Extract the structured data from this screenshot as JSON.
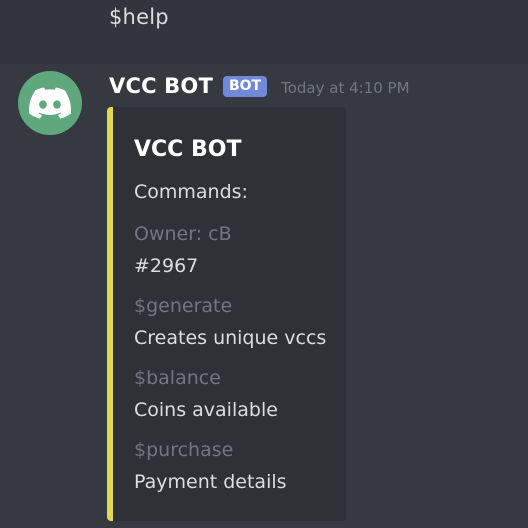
{
  "previous_message": {
    "text": "$help"
  },
  "message": {
    "author": "VCC BOT",
    "bot_tag": "BOT",
    "timestamp": "Today at 4:10 PM",
    "avatar_icon": "discord-logo-icon",
    "avatar_color": "#5fa77d"
  },
  "embed": {
    "accent_color": "#e3d755",
    "title": "VCC BOT",
    "description": "Commands:",
    "fields": [
      {
        "name": "Owner: cB",
        "value": "#2967"
      },
      {
        "name": "$generate",
        "value": "Creates unique vccs"
      },
      {
        "name": "$balance",
        "value": "Coins available"
      },
      {
        "name": "$purchase",
        "value": "Payment details"
      }
    ]
  },
  "colors": {
    "background": "#36393f",
    "bot_tag": "#7289da",
    "embed_background": "#2f3136"
  }
}
